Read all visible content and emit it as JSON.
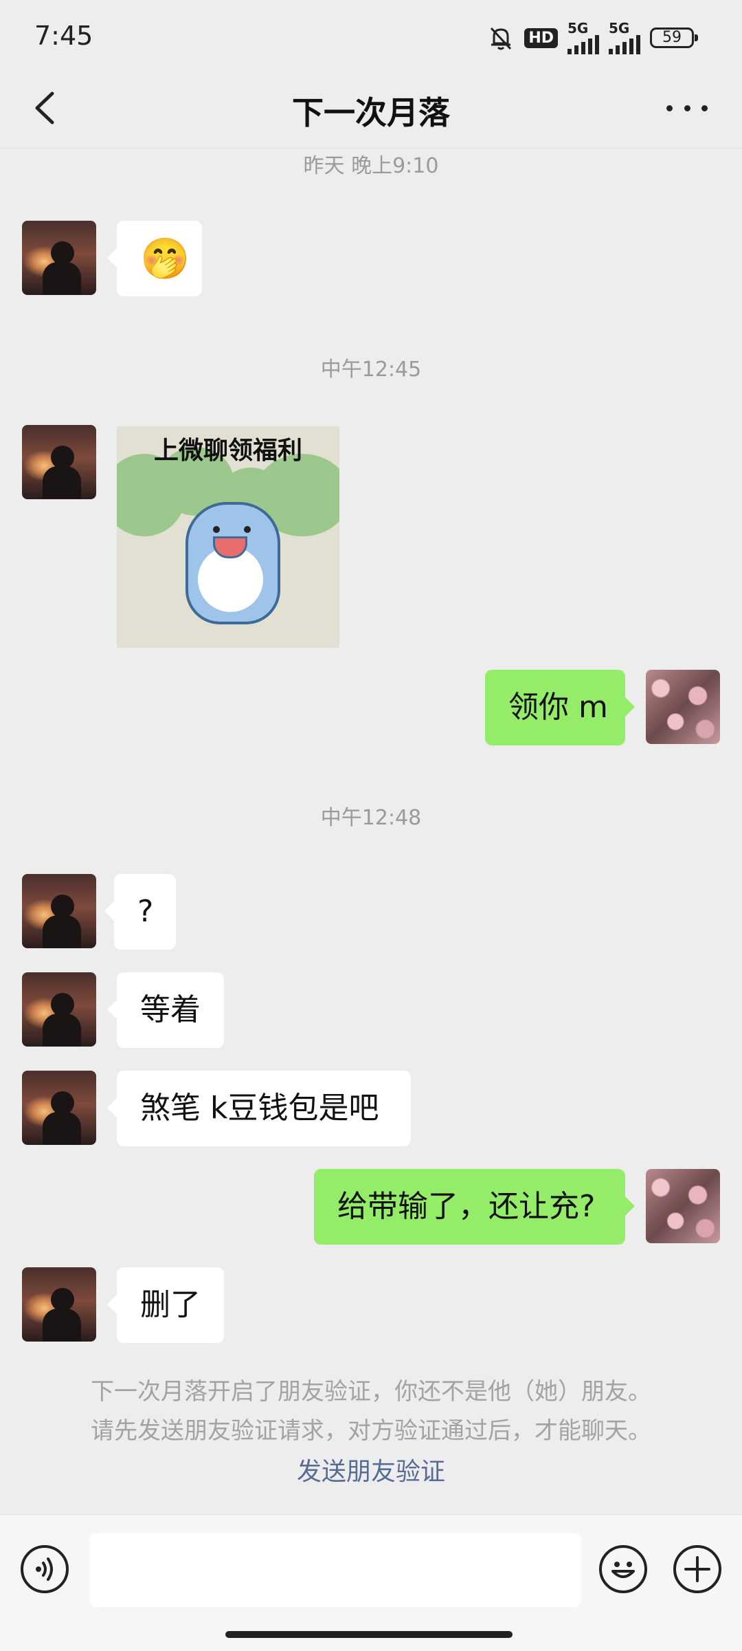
{
  "status_bar": {
    "time": "7:45",
    "hd_label": "HD",
    "network1": "5G",
    "network2": "5G",
    "battery": "59"
  },
  "header": {
    "title": "下一次月落"
  },
  "messages": {
    "ts1": "昨天 晚上9:10",
    "m1_emoji": "🤭",
    "ts2": "中午12:45",
    "sticker_caption": "上微聊领福利",
    "m3": "领你 m",
    "ts3": "中午12:48",
    "m4": "?",
    "m5": "等着",
    "m6": "煞笔 k豆钱包是吧",
    "m7": "给带输了，还让充?",
    "m8": "删了"
  },
  "notice": {
    "line1": "下一次月落开启了朋友验证，你还不是他（她）朋友。",
    "line2": "请先发送朋友验证请求，对方验证通过后，才能聊天。",
    "link": "发送朋友验证"
  },
  "input_bar": {
    "placeholder": ""
  },
  "colors": {
    "background": "#ededed",
    "my_bubble": "#95ec69",
    "their_bubble": "#ffffff",
    "link": "#576b95"
  }
}
